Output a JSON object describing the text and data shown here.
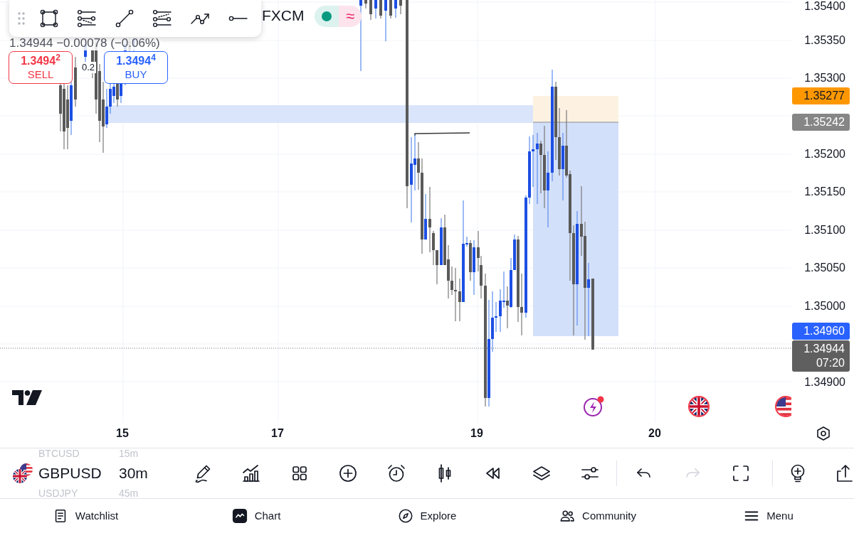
{
  "legend": {
    "exchange": "FXCM",
    "status_symbol": "≈",
    "quote": "1.34944 −0.00078 (−0.06%)"
  },
  "trade_buttons": [
    {
      "kind": "sell",
      "price": "1.3494$^{2}$",
      "label": "SELL"
    },
    {
      "kind": "buy",
      "price": "1.3494$^{4}$",
      "label": "BUY"
    }
  ],
  "spread": "0.2",
  "price_axis": {
    "labels": [
      "1.35400",
      "1.35350",
      "1.35300",
      "1.35200",
      "1.35150",
      "1.35100",
      "1.35050",
      "1.35000",
      "1.34900"
    ]
  },
  "price_tags": [
    {
      "text": "1.35277",
      "color": "#ff9800"
    },
    {
      "text": "1.35242",
      "color": "#868686"
    },
    {
      "text": "1.34960",
      "color": "#2962ff"
    },
    {
      "text": "1.34944",
      "countdown": "07:20",
      "color": "#5f5f5f"
    }
  ],
  "time_axis": {
    "labels": [
      "15",
      "17",
      "19",
      "20"
    ]
  },
  "symbols": [
    {
      "symbol": "BTCUSD",
      "interval": "15m",
      "selected": false
    },
    {
      "symbol": "GBPUSD",
      "interval": "30m",
      "selected": true
    },
    {
      "symbol": "USDJPY",
      "interval": "45m",
      "selected": false
    }
  ],
  "toolbar": {
    "undo": {
      "disabled": false
    },
    "redo": {
      "disabled": true
    }
  },
  "nav": [
    {
      "label": "Watchlist",
      "selected": false
    },
    {
      "label": "Chart",
      "selected": true
    },
    {
      "label": "Explore",
      "selected": false
    },
    {
      "label": "Community",
      "selected": false
    },
    {
      "label": "Menu",
      "selected": false
    }
  ]
}
